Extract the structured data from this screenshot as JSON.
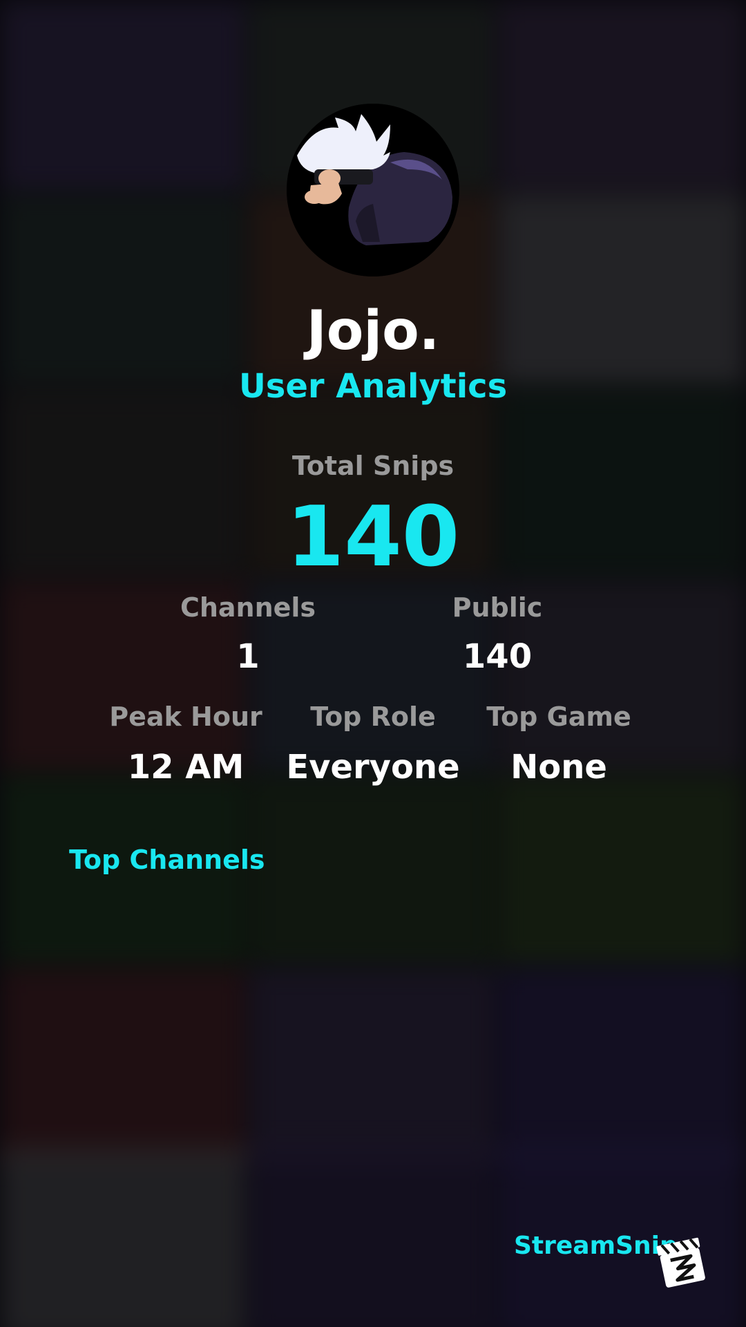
{
  "profile": {
    "username": "Jojo.",
    "subtitle": "User Analytics"
  },
  "stats": {
    "total_snips_label": "Total Snips",
    "total_snips_value": "140",
    "channels_label": "Channels",
    "channels_value": "1",
    "public_label": "Public",
    "public_value": "140",
    "peak_hour_label": "Peak Hour",
    "peak_hour_value": "12 AM",
    "top_role_label": "Top Role",
    "top_role_value": "Everyone",
    "top_game_label": "Top Game",
    "top_game_value": "None"
  },
  "sections": {
    "top_channels_title": "Top Channels"
  },
  "brand": {
    "name": "StreamSnip"
  },
  "icons": {
    "avatar": "anime-character-avatar",
    "logo": "clapperboard-logo-icon"
  },
  "colors": {
    "accent": "#19e7f0",
    "label_gray": "#9a9a9a",
    "text": "#ffffff"
  }
}
